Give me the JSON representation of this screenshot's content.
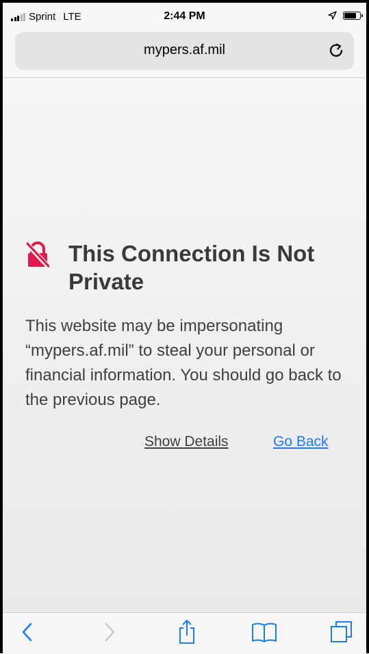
{
  "status_bar": {
    "carrier": "Sprint",
    "network": "LTE",
    "time": "2:44 PM"
  },
  "address_bar": {
    "url": "mypers.af.mil"
  },
  "warning": {
    "title": "This Connection Is Not Private",
    "message": "This website may be impersonating “mypers.af.mil” to steal your personal or financial information. You should go back to the previous page.",
    "show_details_label": "Show Details",
    "go_back_label": "Go Back"
  },
  "colors": {
    "accent": "#1a7cf2",
    "warning_icon": "#e0194c",
    "text": "#3f3f3f"
  },
  "icons": {
    "reload": "reload-icon",
    "warning": "broken-lock-icon",
    "back": "chevron-left-icon",
    "forward": "chevron-right-icon",
    "share": "share-icon",
    "bookmarks": "book-icon",
    "tabs": "tabs-icon"
  }
}
